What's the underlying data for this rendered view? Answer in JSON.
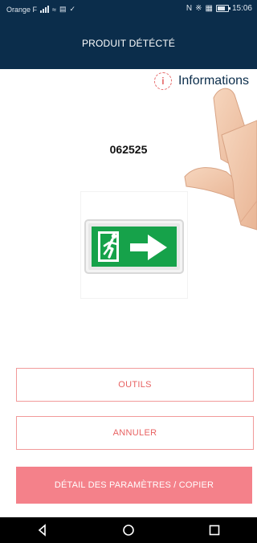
{
  "status_bar": {
    "carrier": "Orange F",
    "time": "15:06",
    "battery_level": "71"
  },
  "header": {
    "title": "PRODUIT DÉTÉCTÉ"
  },
  "info": {
    "icon_label": "i",
    "label": "Informations"
  },
  "product": {
    "code": "062525",
    "image_icon": "exit-sign-icon"
  },
  "buttons": {
    "tools": "OUTILS",
    "cancel": "ANNULER",
    "details": "DÉTAIL DES PARAMÈTRES / COPIER"
  },
  "colors": {
    "header_bg": "#0b2d4b",
    "accent": "#f4818a",
    "outline": "#f19a9a",
    "exit_sign_green": "#16a24a"
  }
}
